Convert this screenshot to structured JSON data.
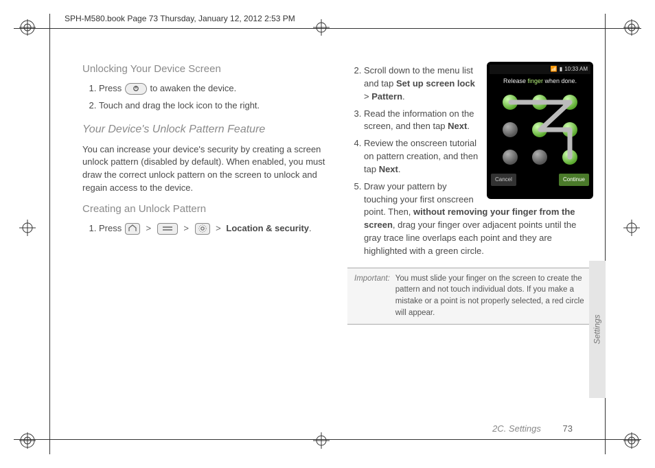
{
  "header": "SPH-M580.book  Page 73  Thursday, January 12, 2012  2:53 PM",
  "left": {
    "h1": "Unlocking Your Device Screen",
    "step1_a": "Press ",
    "step1_b": " to awaken the device.",
    "step2": "Touch and drag the lock icon to the right.",
    "h2": "Your Device's Unlock Pattern Feature",
    "body": "You can increase your device's security by creating a screen unlock pattern (disabled by default). When enabled, you must draw the correct unlock pattern on the screen to unlock and regain access to the device.",
    "h3": "Creating an Unlock Pattern",
    "c_step1_a": "Press ",
    "c_step1_b": "Location & security",
    "c_step1_c": "."
  },
  "right": {
    "s2_a": "Scroll down to the menu list and tap ",
    "s2_b": "Set up screen lock",
    "s2_mid": " > ",
    "s2_c": "Pattern",
    "s2_d": ".",
    "s3_a": "Read the information on the screen, and then tap ",
    "s3_b": "Next",
    "s3_c": ".",
    "s4_a": "Review the onscreen tutorial on pattern creation, and then tap ",
    "s4_b": "Next",
    "s4_c": ".",
    "s5_a": "Draw your pattern by touching your first onscreen point. Then, ",
    "s5_b": "without removing your finger from the screen",
    "s5_c": ", drag your finger over adjacent points until the gray trace line overlaps each point and they are highlighted with a green circle."
  },
  "note": {
    "label": "Important:",
    "text": "You must slide your finger on the screen to create the pattern and not touch individual dots. If you make a mistake or a point is not properly selected, a red circle will appear."
  },
  "device": {
    "time": "10:33 AM",
    "hint_a": "Release ",
    "hint_b": "finger",
    "hint_c": " when done.",
    "btn_cancel": "Cancel",
    "btn_continue": "Continue"
  },
  "side_tab": "Settings",
  "footer": {
    "section": "2C. Settings",
    "page": "73"
  }
}
